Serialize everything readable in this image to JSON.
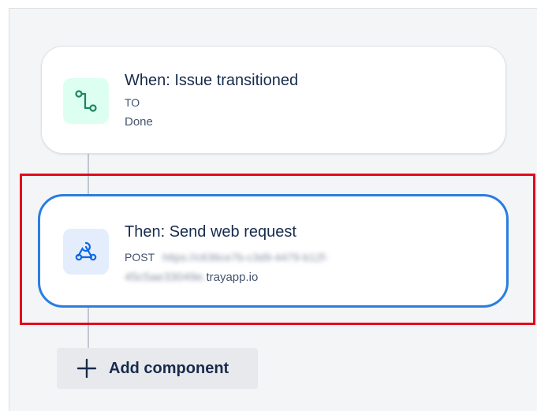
{
  "trigger": {
    "icon": "branch-arrow-icon",
    "title": "When: Issue transitioned",
    "to_label": "TO",
    "to_value": "Done",
    "accent": "#dcfff1"
  },
  "action": {
    "icon": "webhook-icon",
    "title": "Then: Send web request",
    "method": "POST",
    "url_part1_blurred": "https://c636ce7b-c3d9-4479-b12f-",
    "url_part2_blurred": "45c5ae33049e.",
    "url_domain": "trayapp.io",
    "accent": "#2a7de1"
  },
  "add_component": {
    "icon": "plus-icon",
    "label": "Add component"
  },
  "highlight_color": "#e10b1c"
}
